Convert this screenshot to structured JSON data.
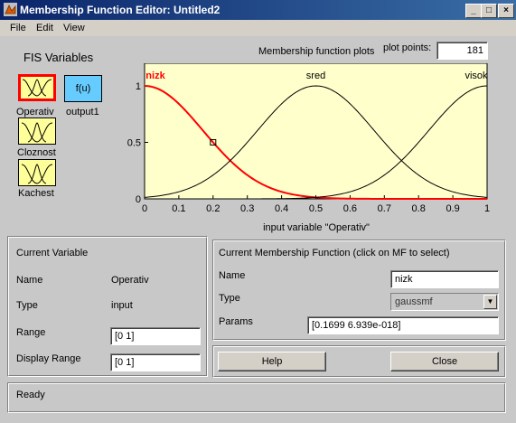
{
  "window": {
    "title": "Membership Function Editor: Untitled2",
    "min": "_",
    "max": "□",
    "close": "×"
  },
  "menu": [
    "File",
    "Edit",
    "View"
  ],
  "fis_vars": {
    "heading": "FIS Variables",
    "inputs": [
      "Operativ",
      "Cloznost",
      "Kachest"
    ],
    "output_label": "output1",
    "output_icon_text": "f(u)"
  },
  "plot": {
    "header": "Membership function plots",
    "points_label": "plot points:",
    "points_value": "181",
    "xlabel": "input variable \"Operativ\"",
    "mf_labels": [
      "nizk",
      "sred",
      "visok"
    ]
  },
  "chart_data": {
    "type": "line",
    "xlabel": "input variable \"Operativ\"",
    "xlim": [
      0,
      1
    ],
    "ylim": [
      0,
      1
    ],
    "x_ticks": [
      "0",
      "0.1",
      "0.2",
      "0.3",
      "0.4",
      "0.5",
      "0.6",
      "0.7",
      "0.8",
      "0.9",
      "1"
    ],
    "y_ticks": [
      "0",
      "0.5",
      "1"
    ],
    "series": [
      {
        "name": "nizk",
        "type": "gaussmf",
        "sigma": 0.1699,
        "center": 0,
        "color": "#ff0000",
        "selected": true
      },
      {
        "name": "sred",
        "type": "gaussmf",
        "sigma": 0.1699,
        "center": 0.5,
        "color": "#000000"
      },
      {
        "name": "visok",
        "type": "gaussmf",
        "sigma": 0.1699,
        "center": 1,
        "color": "#000000"
      }
    ],
    "selected_marker_x": 0.2,
    "background": "#ffffcc"
  },
  "current_variable": {
    "heading": "Current Variable",
    "name_label": "Name",
    "name_value": "Operativ",
    "type_label": "Type",
    "type_value": "input",
    "range_label": "Range",
    "range_value": "[0 1]",
    "display_range_label": "Display Range",
    "display_range_value": "[0 1]"
  },
  "current_mf": {
    "heading": "Current Membership Function (click on MF to select)",
    "name_label": "Name",
    "name_value": "nizk",
    "type_label": "Type",
    "type_value": "gaussmf",
    "params_label": "Params",
    "params_value": "[0.1699 6.939e-018]"
  },
  "buttons": {
    "help": "Help",
    "close": "Close"
  },
  "status": "Ready"
}
